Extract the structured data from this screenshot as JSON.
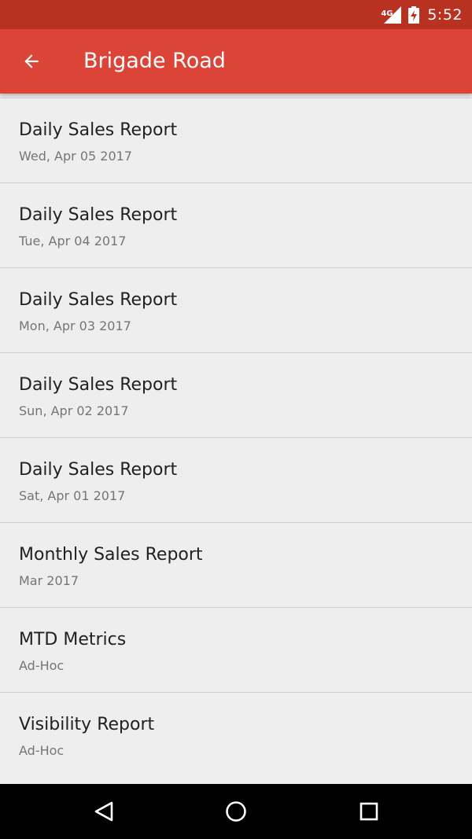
{
  "status_bar": {
    "network_label": "4G",
    "time": "5:52"
  },
  "app_bar": {
    "title": "Brigade Road"
  },
  "reports": [
    {
      "title": "Daily Sales Report",
      "subtitle": "Wed, Apr 05 2017"
    },
    {
      "title": "Daily Sales Report",
      "subtitle": "Tue, Apr 04 2017"
    },
    {
      "title": "Daily Sales Report",
      "subtitle": "Mon, Apr 03 2017"
    },
    {
      "title": "Daily Sales Report",
      "subtitle": "Sun, Apr 02 2017"
    },
    {
      "title": "Daily Sales Report",
      "subtitle": "Sat, Apr 01 2017"
    },
    {
      "title": "Monthly Sales Report",
      "subtitle": "Mar 2017"
    },
    {
      "title": "MTD Metrics",
      "subtitle": "Ad-Hoc"
    },
    {
      "title": "Visibility Report",
      "subtitle": "Ad-Hoc"
    }
  ],
  "icons": {
    "back": "arrow-back-icon",
    "signal": "signal-icon",
    "battery": "battery-charging-icon",
    "nav_back": "triangle-back-icon",
    "nav_home": "circle-home-icon",
    "nav_recents": "square-recents-icon"
  },
  "colors": {
    "status_bar": "#b93221",
    "app_bar": "#db4437",
    "background": "#eeeeee",
    "title_text": "#212121",
    "subtitle_text": "#757575",
    "nav_bar": "#000000"
  }
}
